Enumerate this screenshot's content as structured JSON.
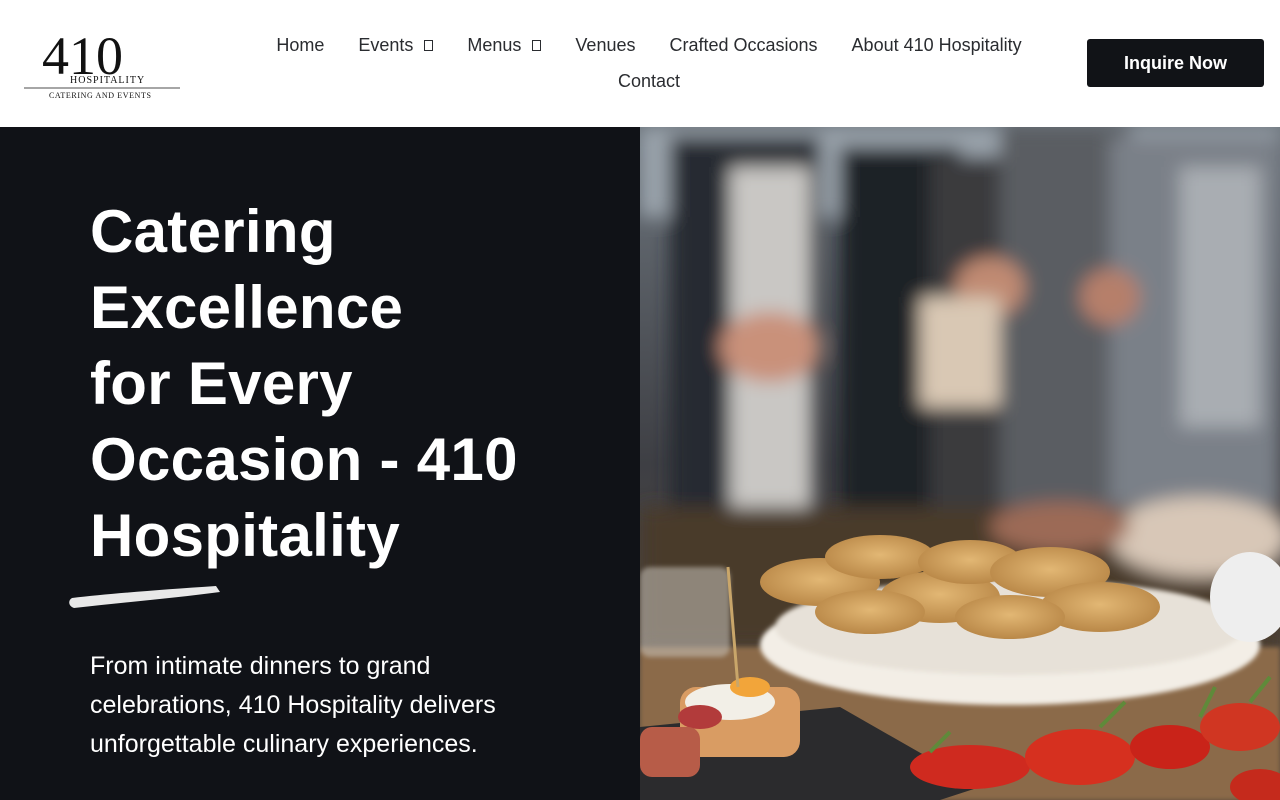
{
  "brand": {
    "logo_number": "410",
    "logo_word": "HOSPITALITY",
    "logo_tagline": "CATERING AND EVENTS"
  },
  "nav": {
    "items": [
      {
        "label": "Home",
        "dropdown": false
      },
      {
        "label": "Events",
        "dropdown": true
      },
      {
        "label": "Menus",
        "dropdown": true
      },
      {
        "label": "Venues",
        "dropdown": false
      },
      {
        "label": "Crafted Occasions",
        "dropdown": false
      },
      {
        "label": "About 410 Hospitality",
        "dropdown": false
      },
      {
        "label": "Contact",
        "dropdown": false
      }
    ]
  },
  "cta": {
    "label": "Inquire Now"
  },
  "hero": {
    "title": "Catering\nExcellence\nfor Every\nOccasion - 410\nHospitality",
    "subtitle": "From intimate dinners to grand celebrations, 410 Hospitality delivers unforgettable culinary experiences.",
    "image_icon": "catering-buffet-photo"
  },
  "colors": {
    "dark": "#101217",
    "button": "#111317",
    "text": "#2a2c30",
    "white": "#ffffff"
  }
}
